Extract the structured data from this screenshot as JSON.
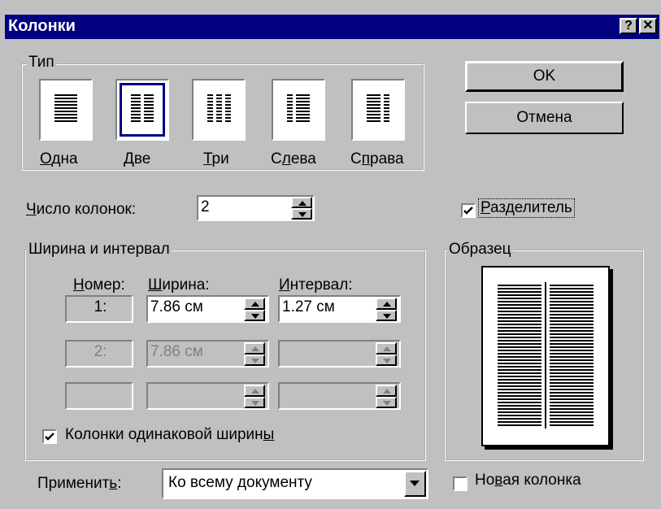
{
  "window": {
    "title": "Колонки",
    "help_label": "?",
    "close_label": "✕"
  },
  "type_group": {
    "label": "Тип",
    "options": [
      {
        "label_ul": "О",
        "label_rest": "дна",
        "selected": false
      },
      {
        "label_ul": "Д",
        "label_rest": "ве",
        "selected": true
      },
      {
        "label_ul": "Т",
        "label_rest": "ри",
        "selected": false
      },
      {
        "label_pre": "С",
        "label_ul": "л",
        "label_rest": "ева",
        "selected": false
      },
      {
        "label_pre": "С",
        "label_ul": "п",
        "label_rest": "рава",
        "selected": false
      }
    ]
  },
  "buttons": {
    "ok": "OK",
    "cancel": "Отмена"
  },
  "num_columns": {
    "label_ul": "Ч",
    "label_rest": "исло колонок:",
    "value": "2"
  },
  "separator": {
    "label_ul": "Р",
    "label_rest": "азделитель",
    "checked": true
  },
  "width_group": {
    "label": "Ширина и интервал",
    "headers": {
      "number_ul": "Н",
      "number_rest": "омер:",
      "width_ul": "Ш",
      "width_rest": "ирина:",
      "spacing_ul": "И",
      "spacing_rest": "нтервал:"
    },
    "rows": [
      {
        "number": "1:",
        "width": "7.86 см",
        "spacing": "1.27 см",
        "enabled": true
      },
      {
        "number": "2:",
        "width": "7.86 см",
        "spacing": "",
        "enabled": false
      },
      {
        "number": "",
        "width": "",
        "spacing": "",
        "enabled": false
      }
    ],
    "equal_width": {
      "label_pre": "Колонки одинаковой ширин",
      "label_ul": "ы",
      "checked": true
    }
  },
  "preview_group": {
    "label": "Образец"
  },
  "apply": {
    "label_pre": "Применит",
    "label_ul": "ь",
    "label_rest": ":",
    "value": "Ко всему документу"
  },
  "new_column": {
    "label_pre": "Но",
    "label_ul": "в",
    "label_rest": "ая колонка",
    "checked": false
  }
}
